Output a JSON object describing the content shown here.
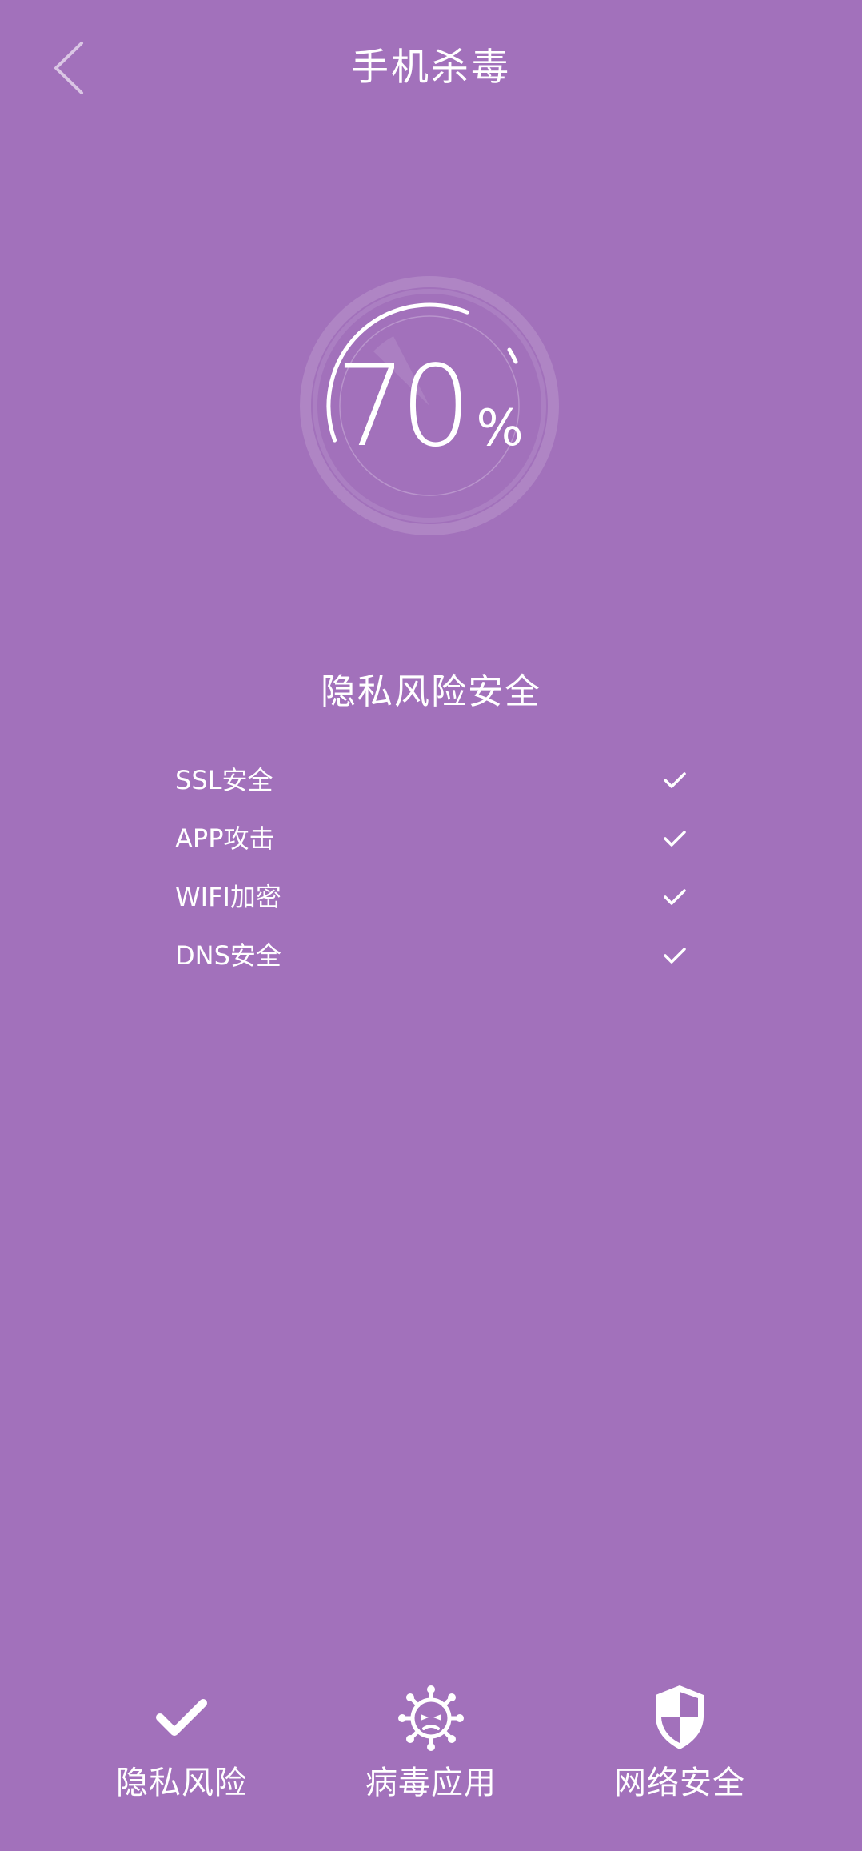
{
  "header": {
    "title": "手机杀毒",
    "back_icon": "chevron-left-icon"
  },
  "scan": {
    "progress_value": "70",
    "progress_unit": "%",
    "progress_fraction": 0.7
  },
  "section": {
    "title": "隐私风险安全"
  },
  "checks": [
    {
      "label": "SSL安全",
      "status": "check-icon"
    },
    {
      "label": "APP攻击",
      "status": "check-icon"
    },
    {
      "label": "WIFI加密",
      "status": "check-icon"
    },
    {
      "label": "DNS安全",
      "status": "check-icon"
    }
  ],
  "tabs": [
    {
      "label": "隐私风险",
      "icon": "check-icon"
    },
    {
      "label": "病毒应用",
      "icon": "virus-icon"
    },
    {
      "label": "网络安全",
      "icon": "shield-icon"
    }
  ],
  "colors": {
    "background": "#a271bb",
    "foreground": "#ffffff"
  }
}
